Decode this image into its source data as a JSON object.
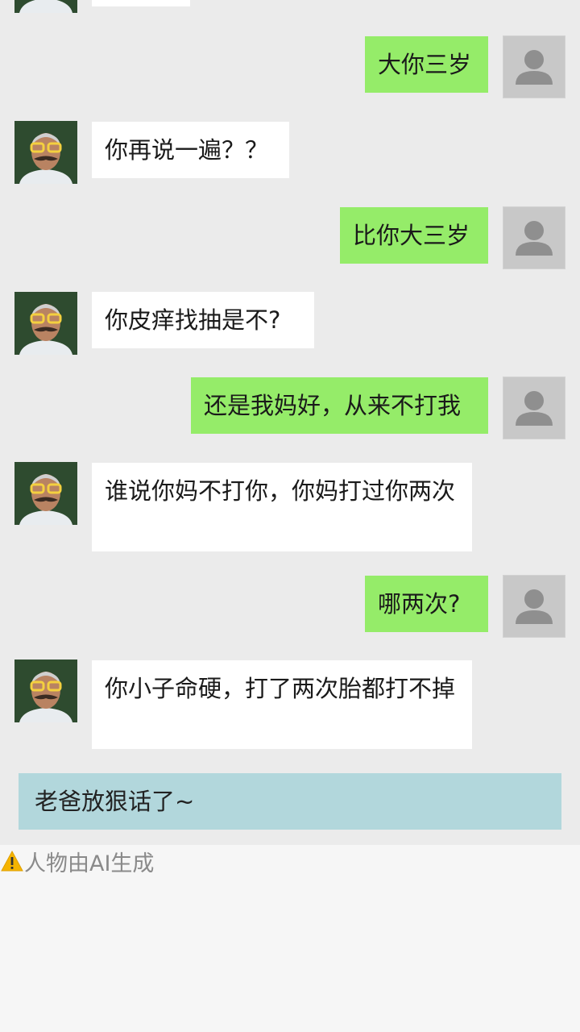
{
  "messages": [
    {
      "sender": "dad",
      "text": ""
    },
    {
      "sender": "me",
      "text": "大你三岁"
    },
    {
      "sender": "dad",
      "text": "你再说一遍？？"
    },
    {
      "sender": "me",
      "text": "比你大三岁"
    },
    {
      "sender": "dad",
      "text": "你皮痒找抽是不?"
    },
    {
      "sender": "me",
      "text": "还是我妈好，从来不打我"
    },
    {
      "sender": "dad",
      "text": "谁说你妈不打你，你妈打过你两次"
    },
    {
      "sender": "me",
      "text": "哪两次?"
    },
    {
      "sender": "dad",
      "text": "你小子命硬，打了两次胎都打不掉"
    }
  ],
  "notice": "老爸放狠话了~",
  "ai_note": "人物由AI生成",
  "colors": {
    "background": "#ebebeb",
    "my_bubble": "#95ec69",
    "other_bubble": "#ffffff",
    "notice_bar": "#b2d7dc",
    "warning": "#f5b400"
  },
  "icons": {
    "my_avatar": "default-user-avatar-icon",
    "dad_avatar": "dad-photo-avatar",
    "warning": "warning-icon"
  }
}
